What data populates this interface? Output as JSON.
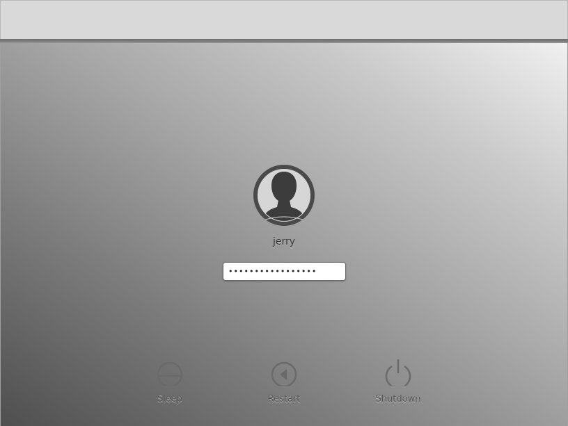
{
  "login": {
    "username": "jerry",
    "password_masked": "•••••••••••••••••",
    "password_field_type": "password"
  },
  "power_actions": [
    {
      "label": "Sleep",
      "icon": "sleep-icon"
    },
    {
      "label": "Restart",
      "icon": "restart-icon"
    },
    {
      "label": "Shutdown",
      "icon": "power-icon"
    }
  ],
  "colors": {
    "top_bar": "#d9d9d9",
    "avatar_ring": "#4a4a4a",
    "avatar_fill": "#3c3c3c",
    "icon": "#6a6a6a"
  }
}
